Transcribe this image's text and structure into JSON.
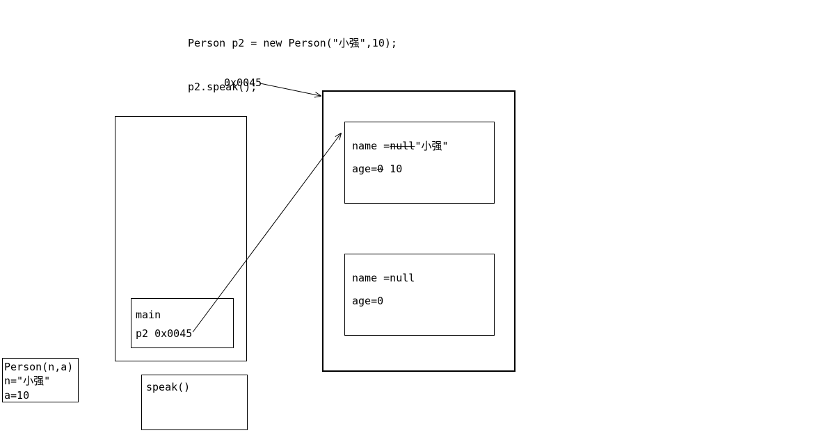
{
  "code": {
    "line1": "Person p2 = new Person(\"小强\",10);",
    "line2": "p2.speak();"
  },
  "addressLabel": "0x0045",
  "stack": {
    "mainFrame": {
      "label": "main",
      "varLine": "p2 0x0045"
    }
  },
  "heap": {
    "obj1": {
      "namePrefix": "name =",
      "nameOld": "null",
      "nameNew": "\"小强\"",
      "agePrefix": "age=",
      "ageOld": "0",
      "ageNew": " 10"
    },
    "obj2": {
      "nameLine": "name =null",
      "ageLine": "age=0"
    }
  },
  "personCtor": {
    "header": "Person(n,a)",
    "nLine": "n=\"小强\"",
    "aLine": "a=10"
  },
  "speakBox": {
    "label": "speak()"
  }
}
